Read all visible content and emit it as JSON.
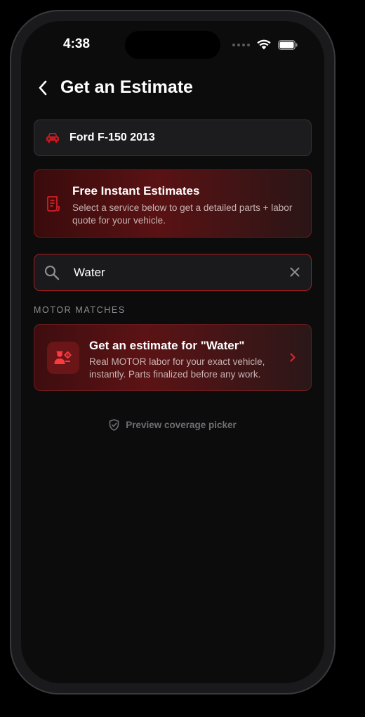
{
  "status_bar": {
    "time": "4:38"
  },
  "header": {
    "back_icon": "chevron-left-icon",
    "title": "Get an Estimate"
  },
  "vehicle": {
    "icon": "car-icon",
    "name": "Ford F-150 2013"
  },
  "promo": {
    "icon": "receipt-icon",
    "title": "Free Instant Estimates",
    "description": "Select a service below to get a detailed parts + labor quote for your vehicle."
  },
  "search": {
    "value": "Water",
    "icon": "search-icon",
    "clear_icon": "close-icon"
  },
  "matches": {
    "section_label": "MOTOR MATCHES",
    "items": [
      {
        "icon": "mechanic-icon",
        "title": "Get an estimate for \"Water\"",
        "description": "Real MOTOR labor for your exact vehicle, instantly. Parts finalized before any work."
      }
    ]
  },
  "preview_link": {
    "icon": "shield-check-icon",
    "label": "Preview coverage picker"
  },
  "colors": {
    "accent": "#c8191e",
    "background": "#0c0c0d",
    "card": "#1c1c1e"
  }
}
